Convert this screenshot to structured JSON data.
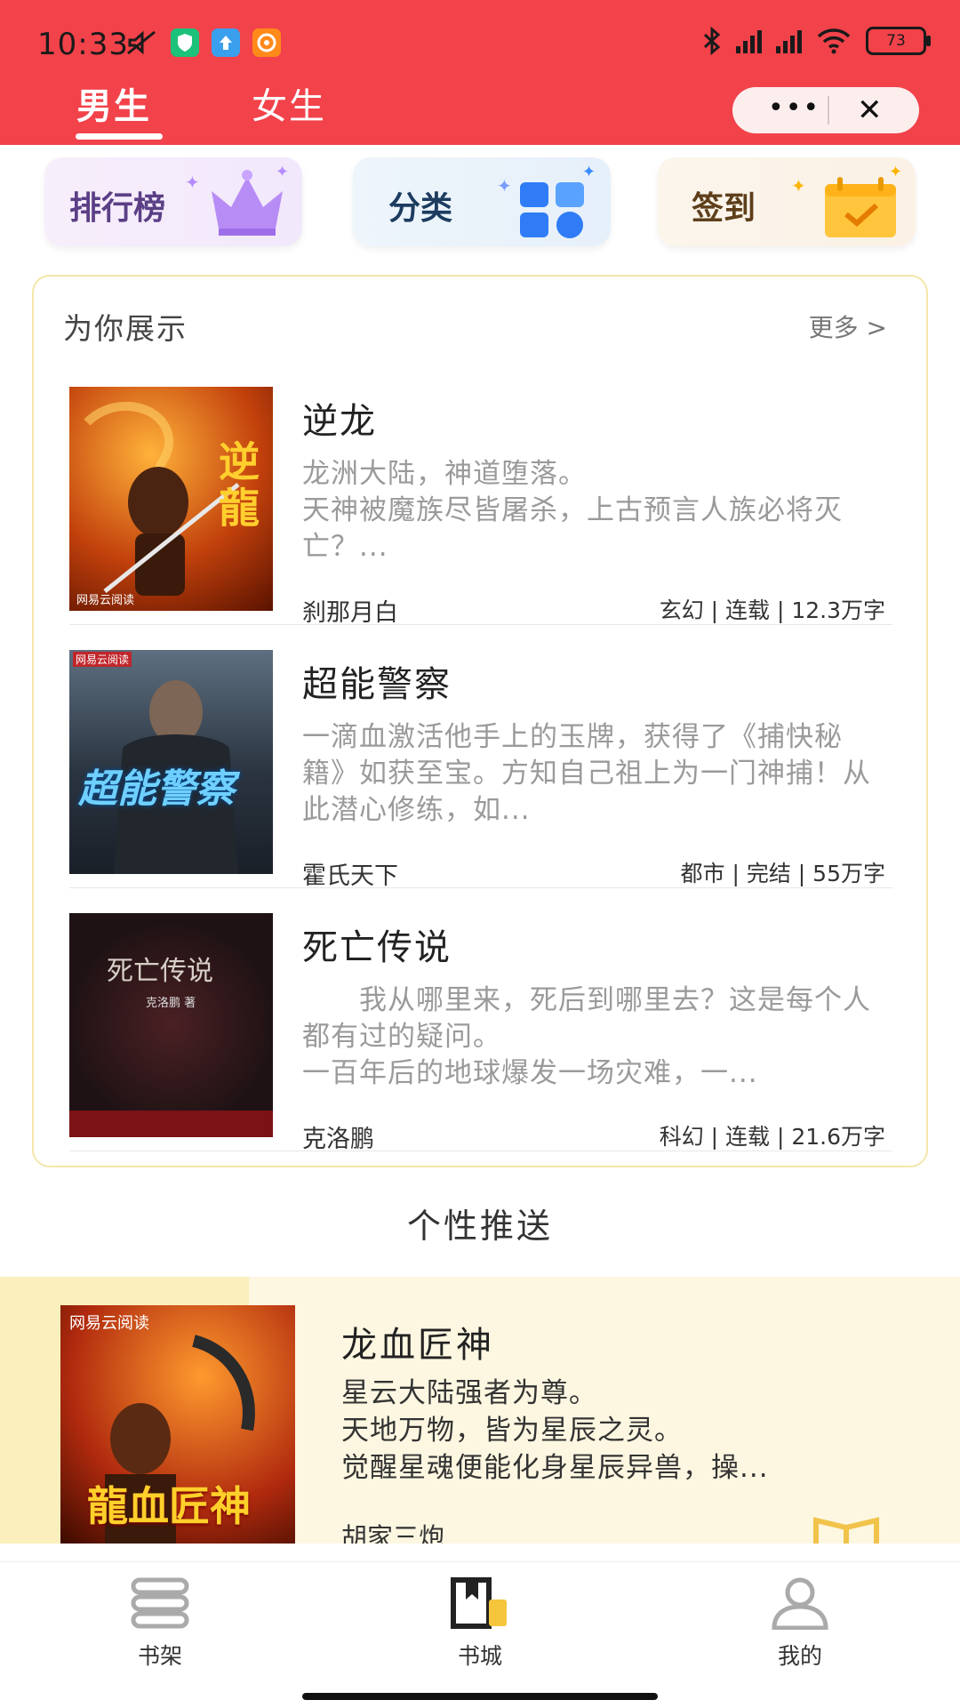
{
  "status_bar": {
    "time": "10:33",
    "battery": "73",
    "icons": [
      "mute-icon",
      "shield-app-icon",
      "upload-app-icon",
      "film-app-icon",
      "bluetooth-icon",
      "hd-signal-icon",
      "hd-signal-icon",
      "wifi-icon",
      "battery-icon"
    ]
  },
  "header": {
    "tabs": [
      {
        "label": "男生",
        "active": true
      },
      {
        "label": "女生",
        "active": false
      }
    ],
    "capsule": {
      "more": "•••",
      "close": "✕"
    },
    "bg_color": "#f2424a"
  },
  "quick_entries": [
    {
      "label": "排行榜",
      "icon": "crown-icon"
    },
    {
      "label": "分类",
      "icon": "grid-apps-icon"
    },
    {
      "label": "签到",
      "icon": "calendar-check-icon"
    }
  ],
  "showcase": {
    "title": "为你展示",
    "more": "更多 >",
    "books": [
      {
        "title": "逆龙",
        "intro": "龙洲大陆，神道堕落。\n天神被魔族尽皆屠杀，上古预言人族必将灭亡？...",
        "author": "刹那月白",
        "meta": "玄幻 | 连载 | 12.3万字",
        "cover_text": "逆龍",
        "cover_tag": "网易云阅读"
      },
      {
        "title": "超能警察",
        "intro": "一滴血激活他手上的玉牌，获得了《捕快秘籍》如获至宝。方知自己祖上为一门神捕！从此潜心修练，如...",
        "author": "霍氏天下",
        "meta": "都市 | 完结 | 55万字",
        "cover_text": "超能警察",
        "cover_tag": "网易云阅读"
      },
      {
        "title": "死亡传说",
        "intro": "　　我从哪里来，死后到哪里去？这是每个人都有过的疑问。\n一百年后的地球爆发一场灾难，一...",
        "author": "克洛鹏",
        "meta": "科幻 | 连载 | 21.6万字",
        "cover_text": "死亡传说",
        "cover_tag": "克洛鹏 著"
      }
    ]
  },
  "push": {
    "section_title": "个性推送",
    "book": {
      "title": "龙血匠神",
      "intro": "星云大陆强者为尊。\n天地万物，皆为星辰之灵。\n觉醒星魂便能化身星辰异兽，操...",
      "author": "胡家三炮",
      "cover_tag": "网易云阅读",
      "cover_text": "龍血匠神"
    }
  },
  "bottom_nav": [
    {
      "label": "书架",
      "icon": "bookshelf-icon",
      "active": false
    },
    {
      "label": "书城",
      "icon": "book-store-icon",
      "active": true
    },
    {
      "label": "我的",
      "icon": "user-icon",
      "active": false
    }
  ]
}
